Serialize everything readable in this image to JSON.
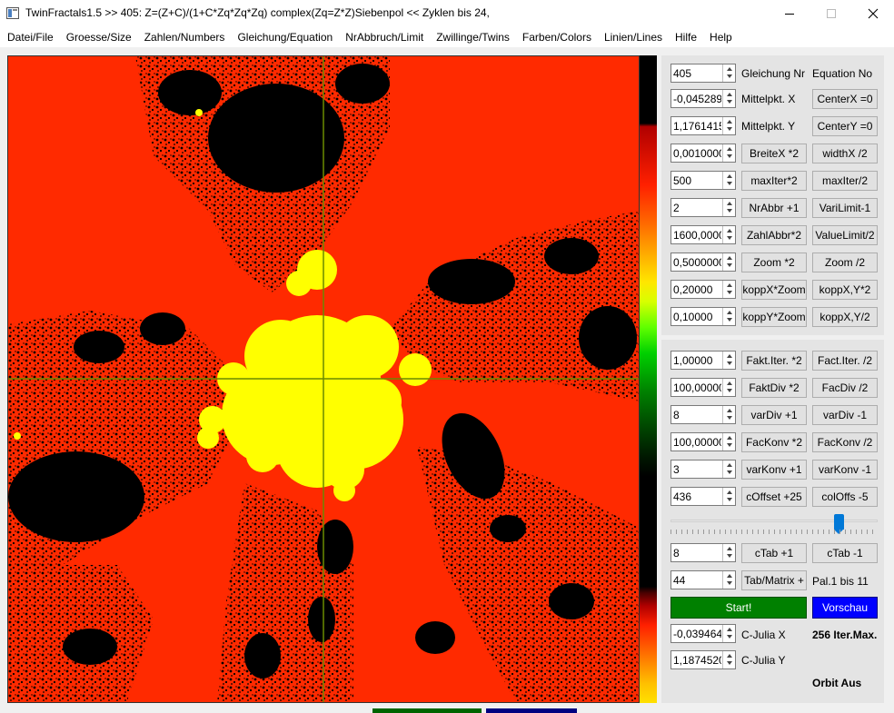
{
  "window": {
    "title": "TwinFractals1.5 >> 405: Z=(Z+C)/(1+C*Zq*Zq*Zq) complex(Zq=Z*Z)Siebenpol <<  Zyklen bis 24,"
  },
  "menu": [
    "Datei/File",
    "Groesse/Size",
    "Zahlen/Numbers",
    "Gleichung/Equation",
    "NrAbbruch/Limit",
    "Zwillinge/Twins",
    "Farben/Colors",
    "Linien/Lines",
    "Hilfe",
    "Help"
  ],
  "colors": {
    "background": "#ff2a00",
    "set": "#000000",
    "main_bulb": "#ffff00",
    "crosshair": "#6a8a00",
    "start": "#008000",
    "preview": "#0000ff"
  },
  "controls": {
    "equation_no": {
      "value": "405",
      "label": "Gleichung Nr",
      "label2": "Equation No"
    },
    "center_x": {
      "value": "-0,0452890",
      "label": "Mittelpkt. X",
      "button": "CenterX =0"
    },
    "center_y": {
      "value": "1,1761415000",
      "label": "Mittelpkt. Y",
      "button": "CenterY =0"
    },
    "width": {
      "value": "0,0010000",
      "btn1": "BreiteX *2",
      "btn2": "widthX /2"
    },
    "max_iter": {
      "value": "500",
      "btn1": "maxIter*2",
      "btn2": "maxIter/2"
    },
    "nr_abbr": {
      "value": "2",
      "btn1": "NrAbbr +1",
      "btn2": "VariLimit-1"
    },
    "zahl_abbr": {
      "value": "1600,0000",
      "btn1": "ZahlAbbr*2",
      "btn2": "ValueLimit/2"
    },
    "zoom": {
      "value": "0,5000000",
      "btn1": "Zoom *2",
      "btn2": "Zoom /2"
    },
    "kopp_x": {
      "value": "0,20000",
      "btn1": "koppX*Zoom",
      "btn2": "koppX,Y*2"
    },
    "kopp_y": {
      "value": "0,10000",
      "btn1": "koppY*Zoom",
      "btn2": "koppX,Y/2"
    },
    "fakt_iter": {
      "value": "1,00000",
      "btn1": "Fakt.Iter. *2",
      "btn2": "Fact.Iter. /2"
    },
    "fakt_div": {
      "value": "100,00000",
      "btn1": "FaktDiv *2",
      "btn2": "FacDiv /2"
    },
    "var_div": {
      "value": "8",
      "btn1": "varDiv +1",
      "btn2": "varDiv -1"
    },
    "fac_konv": {
      "value": "100,00000",
      "btn1": "FacKonv *2",
      "btn2": "FacKonv /2"
    },
    "var_konv": {
      "value": "3",
      "btn1": "varKonv +1",
      "btn2": "varKonv -1"
    },
    "c_offset": {
      "value": "436",
      "btn1": "cOffset +25",
      "btn2": "colOffs -5"
    },
    "c_tab": {
      "value": "8",
      "btn1": "cTab +1",
      "btn2": "cTab -1"
    },
    "tab_matrix": {
      "value": "44",
      "btn1": "Tab/Matrix +",
      "label": "Pal.1 bis 11"
    },
    "start_label": "Start!",
    "preview_label": "Vorschau",
    "julia_x": {
      "value": "-0,0394649",
      "label": "C-Julia X",
      "info": "256 Iter.Max."
    },
    "julia_y": {
      "value": "1,1874520",
      "label": "C-Julia Y",
      "info": "Orbit Aus"
    },
    "slider": {
      "fraction": 0.83
    }
  }
}
